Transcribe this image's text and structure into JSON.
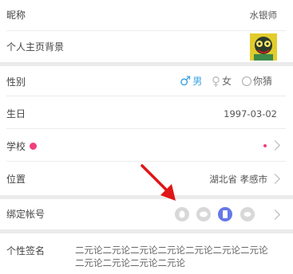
{
  "nickname": {
    "label": "昵称",
    "value": "水银师"
  },
  "background": {
    "label": "个人主页背景"
  },
  "gender": {
    "label": "性别",
    "options": [
      {
        "symbol": "♂",
        "text": "男",
        "selected": true
      },
      {
        "symbol": "♀",
        "text": "女",
        "selected": false
      },
      {
        "symbol": "?",
        "text": "你猜",
        "selected": false
      }
    ]
  },
  "birthday": {
    "label": "生日",
    "value": "1997-03-02"
  },
  "school": {
    "label": "学校",
    "badge_color": "#f0407a"
  },
  "location": {
    "label": "位置",
    "value": "湖北省 孝感市"
  },
  "bind_account": {
    "label": "绑定帐号",
    "icons": [
      "qq-icon",
      "wechat-icon",
      "phone-icon",
      "weibo-icon"
    ],
    "active_icon": "phone-icon"
  },
  "signature": {
    "label": "个性签名",
    "value": "二元论二元论二元论二元论二元论二元论二元论二元论二元论二元论二元论"
  },
  "colors": {
    "accent": "#3aa3e3",
    "active_account": "#6677e8",
    "arrow": "#e01515"
  }
}
